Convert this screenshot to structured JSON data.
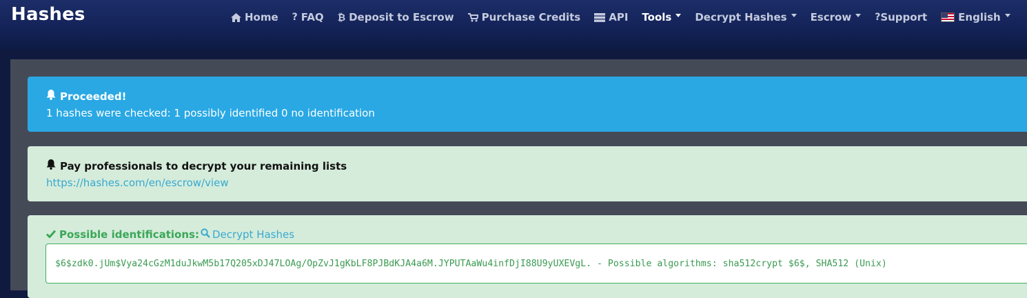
{
  "brand": "Hashes",
  "nav": [
    {
      "label": "Home",
      "icon": "home-icon"
    },
    {
      "label": "FAQ",
      "icon": "question-icon"
    },
    {
      "label": "Deposit to Escrow",
      "icon": "bitcoin-icon"
    },
    {
      "label": "Purchase Credits",
      "icon": "cart-icon"
    },
    {
      "label": "API",
      "icon": "server-icon"
    },
    {
      "label": "Tools",
      "dropdown": true
    },
    {
      "label": "Decrypt Hashes",
      "dropdown": true
    },
    {
      "label": "Escrow",
      "dropdown": true
    },
    {
      "label": "Support",
      "icon": "question-icon"
    },
    {
      "label": "English",
      "icon": "us-flag-icon",
      "dropdown": true
    }
  ],
  "alerts": {
    "proceeded": {
      "title": "Proceeded!",
      "text": "1 hashes were checked: 1 possibly identified 0 no identification"
    },
    "pay": {
      "title": "Pay professionals to decrypt your remaining lists",
      "link": "https://hashes.com/en/escrow/view"
    },
    "identifications": {
      "label": "Possible identifications:",
      "link_label": "Decrypt Hashes",
      "result": "$6$zdk0.jUm$Vya24cGzM1duJkwM5b17Q205xDJ47LOAg/OpZvJ1gKbLF8PJBdKJA4a6M.JYPUTAaWu4infDjI88U9yUXEVgL. - Possible algorithms: sha512crypt $6$, SHA512 (Unix)"
    }
  },
  "colors": {
    "info": "#29a8e4",
    "success_bg": "#d5ecdb",
    "success_text": "#3aa757",
    "link": "#37a9cf"
  }
}
